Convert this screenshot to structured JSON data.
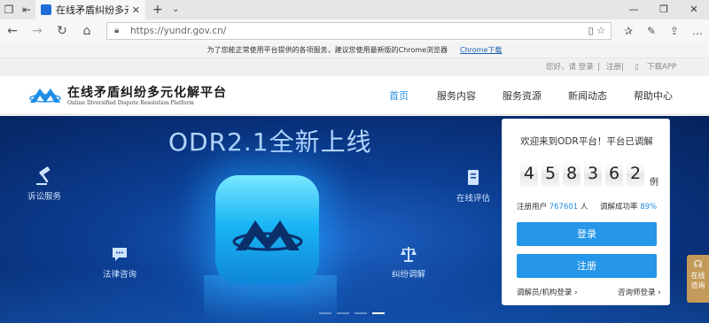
{
  "browser": {
    "tab_title": "在线矛盾纠纷多元化解平",
    "url": "https://yundr.gov.cn/"
  },
  "notice": {
    "text": "为了您能正常使用平台提供的各项服务，建议您使用最新版的Chrome浏览器",
    "link": "Chrome下载"
  },
  "userbar": {
    "greeting": "您好，请 登录",
    "sep": "|",
    "register": "注册",
    "download_app": "下载APP"
  },
  "header": {
    "site_name": "在线矛盾纠纷多元化解平台",
    "site_name_en": "Online Diversified Dispute Resolution Platform",
    "nav": [
      "首页",
      "服务内容",
      "服务资源",
      "新闻动态",
      "帮助中心"
    ]
  },
  "hero": {
    "title": "ODR2.1全新上线",
    "services": [
      "诉讼服务",
      "在线评估",
      "法律咨询",
      "纠纷调解"
    ]
  },
  "login_card": {
    "welcome": "欢迎来到ODR平台！平台已调解",
    "digits": [
      "4",
      "5",
      "8",
      "3",
      "6",
      "2"
    ],
    "unit": "例",
    "users_label": "注册用户",
    "users_count": "767601",
    "users_unit": "人",
    "success_label": "调解成功率",
    "success_rate": "89%",
    "login_button": "登录",
    "register_button": "注册",
    "mediator_login": "调解员/机构登录",
    "counselor_login": "咨询师登录"
  },
  "side_help": {
    "line1": "在线",
    "line2": "咨询"
  },
  "colors": {
    "accent": "#2596e8",
    "hero_dark": "#082d72",
    "help_tab": "#c39a5a"
  }
}
